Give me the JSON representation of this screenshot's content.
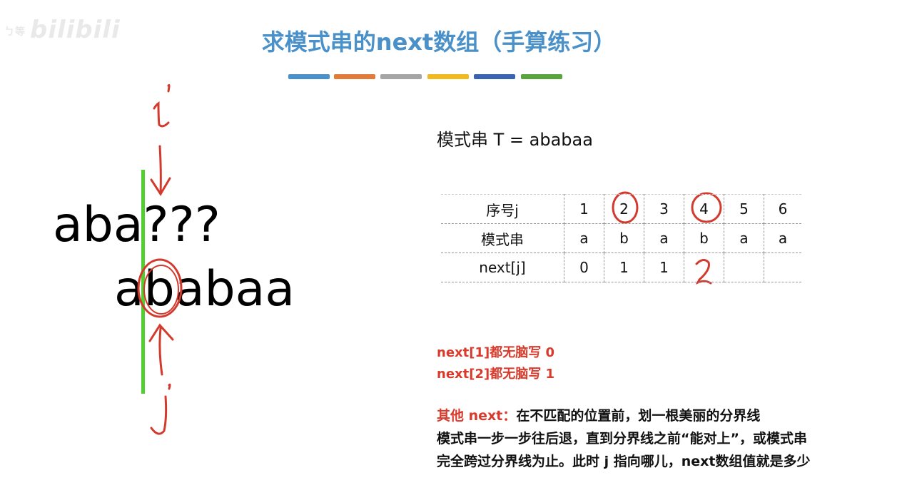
{
  "watermark": {
    "small": "ㄅ等",
    "logo": "bilibili"
  },
  "title": "求模式串的next数组（手算练习）",
  "color_bars": [
    "#4a90c9",
    "#e07b39",
    "#a5a5a5",
    "#f0b91f",
    "#3b64b0",
    "#5aa43d"
  ],
  "pattern_label": "模式串 T = ababaa",
  "left_diagram": {
    "main_string": "aba???",
    "pattern_string": "ababaa",
    "marker_top": "i",
    "marker_bottom": "j"
  },
  "table": {
    "row_labels": [
      "序号j",
      "模式串",
      "next[j]"
    ],
    "indices": [
      "1",
      "2",
      "3",
      "4",
      "5",
      "6"
    ],
    "pattern": [
      "a",
      "b",
      "a",
      "b",
      "a",
      "a"
    ],
    "next": [
      "0",
      "1",
      "1",
      "2",
      "",
      ""
    ],
    "handwritten_next": "2"
  },
  "rules": {
    "rule1": "next[1]都无脑写 0",
    "rule2": "next[2]都无脑写 1"
  },
  "explanation": {
    "lead": "其他 next：",
    "line1": "在不匹配的位置前，划一根美丽的分界线",
    "line2": "模式串一步一步往后退，直到分界线之前“能对上”，或模式串",
    "line3": "完全跨过分界线为止。此时 j 指向哪儿，next数组值就是多少"
  }
}
